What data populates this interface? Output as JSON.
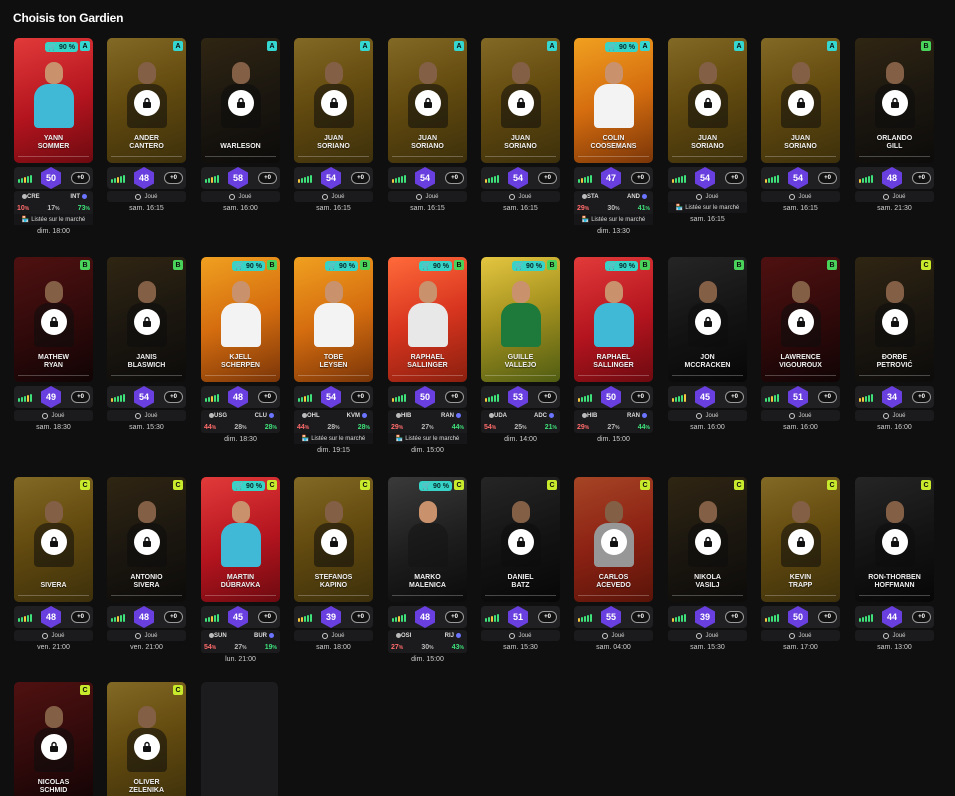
{
  "page": {
    "title": "Choisis ton Gardien"
  },
  "labels": {
    "joue": "Joué",
    "plus_zero": "+0",
    "market": "Listée sur le marché"
  },
  "colors": {
    "score": "#6a3fe0",
    "rarity_A": "#35d7d0",
    "rarity_B": "#49d35a",
    "rarity_C": "#c7ea2c",
    "bar_green": "#3ee17a",
    "bar_yellow": "#f5c842",
    "bar_red": "#ff4d4d"
  },
  "rows": [
    [
      {
        "name": "YANN\nSOMMER",
        "rarity": "A",
        "pill": "90 %",
        "skin": "red",
        "locked": false,
        "score": "50",
        "bars": [
          "g",
          "g",
          "y",
          "g",
          "g"
        ],
        "mode": "match",
        "home": "CRE",
        "away": "INT",
        "pcts": [
          "10",
          "17",
          "73"
        ],
        "market": true,
        "time": "dim. 18:00"
      },
      {
        "name": "ANDER\nCANTERO",
        "rarity": "A",
        "skin": "gold",
        "locked": true,
        "score": "48",
        "bars": [
          "g",
          "g",
          "y",
          "g",
          "g"
        ],
        "mode": "joue",
        "time": "sam. 16:15"
      },
      {
        "name": "WARLESON",
        "rarity": "A",
        "skin": "dark",
        "locked": true,
        "score": "58",
        "bars": [
          "g",
          "g",
          "y",
          "g",
          "g"
        ],
        "mode": "joue",
        "time": "sam. 16:00"
      },
      {
        "name": "JUAN\nSORIANO",
        "rarity": "A",
        "skin": "gold",
        "locked": true,
        "score": "54",
        "bars": [
          "y",
          "g",
          "g",
          "g",
          "g"
        ],
        "mode": "joue",
        "time": "sam. 16:15"
      },
      {
        "name": "JUAN\nSORIANO",
        "rarity": "A",
        "skin": "gold",
        "locked": true,
        "score": "54",
        "bars": [
          "y",
          "g",
          "g",
          "g",
          "g"
        ],
        "mode": "joue",
        "time": "sam. 16:15"
      },
      {
        "name": "JUAN\nSORIANO",
        "rarity": "A",
        "skin": "gold",
        "locked": true,
        "score": "54",
        "bars": [
          "y",
          "g",
          "g",
          "g",
          "g"
        ],
        "mode": "joue",
        "time": "sam. 16:15"
      },
      {
        "name": "COLIN\nCOOSEMANS",
        "rarity": "A",
        "pill": "90 %",
        "skin": "orange",
        "locked": false,
        "score": "47",
        "bars": [
          "g",
          "y",
          "g",
          "g",
          "g"
        ],
        "mode": "match",
        "home": "STA",
        "away": "AND",
        "pcts": [
          "29",
          "30",
          "41"
        ],
        "market": true,
        "time": "dim. 13:30"
      },
      {
        "name": "JUAN\nSORIANO",
        "rarity": "A",
        "skin": "gold",
        "locked": true,
        "score": "54",
        "bars": [
          "y",
          "g",
          "g",
          "g",
          "g"
        ],
        "mode": "joue",
        "market": true,
        "time": "sam. 16:15"
      },
      {
        "name": "JUAN\nSORIANO",
        "rarity": "A",
        "skin": "gold",
        "locked": true,
        "score": "54",
        "bars": [
          "y",
          "g",
          "g",
          "g",
          "g"
        ],
        "mode": "joue",
        "time": "sam. 16:15"
      },
      {
        "name": "ORLANDO\nGILL",
        "rarity": "B",
        "skin": "dark",
        "locked": true,
        "score": "48",
        "bars": [
          "y",
          "g",
          "g",
          "g",
          "g"
        ],
        "mode": "joue",
        "time": "sam. 21:30"
      }
    ],
    [
      {
        "name": "MATHEW\nRYAN",
        "rarity": "B",
        "skin": "darkred",
        "locked": true,
        "score": "49",
        "bars": [
          "g",
          "g",
          "g",
          "y",
          "g"
        ],
        "mode": "joue",
        "time": "sam. 18:30"
      },
      {
        "name": "JANIS\nBLASWICH",
        "rarity": "B",
        "skin": "dark",
        "locked": true,
        "score": "54",
        "bars": [
          "y",
          "g",
          "g",
          "g",
          "g"
        ],
        "mode": "joue",
        "time": "sam. 15:30"
      },
      {
        "name": "KJELL\nSCHERPEN",
        "rarity": "B",
        "pill": "90 %",
        "skin": "orange",
        "locked": false,
        "score": "48",
        "bars": [
          "g",
          "g",
          "y",
          "g",
          "g"
        ],
        "mode": "match",
        "home": "USG",
        "away": "CLU",
        "pcts": [
          "44",
          "28",
          "28"
        ],
        "time": "dim. 18:30"
      },
      {
        "name": "TOBE\nLEYSEN",
        "rarity": "B",
        "pill": "90 %",
        "skin": "orange",
        "locked": false,
        "score": "54",
        "bars": [
          "g",
          "g",
          "y",
          "g",
          "g"
        ],
        "mode": "match",
        "home": "OHL",
        "away": "KVM",
        "pcts": [
          "44",
          "28",
          "28"
        ],
        "market": true,
        "time": "dim. 19:15"
      },
      {
        "name": "Raphael\nSallinger",
        "rarity": "B",
        "pill": "90 %",
        "skin": "redorange",
        "locked": false,
        "score": "50",
        "bars": [
          "y",
          "g",
          "g",
          "g",
          "g"
        ],
        "mode": "match",
        "home": "HIB",
        "away": "RAN",
        "pcts": [
          "29",
          "27",
          "44"
        ],
        "market": true,
        "time": "dim. 15:00"
      },
      {
        "name": "GUILLE\nVALLEJO",
        "rarity": "B",
        "pill": "90 %",
        "skin": "green",
        "locked": false,
        "score": "53",
        "bars": [
          "y",
          "g",
          "g",
          "g",
          "g"
        ],
        "mode": "match",
        "home": "UDA",
        "away": "ADC",
        "pcts": [
          "54",
          "25",
          "21"
        ],
        "time": "dim. 14:00"
      },
      {
        "name": "RAPHAEL\nSALLINGER",
        "rarity": "B",
        "pill": "90 %",
        "skin": "red",
        "locked": false,
        "score": "50",
        "bars": [
          "y",
          "g",
          "g",
          "g",
          "g"
        ],
        "mode": "match",
        "home": "HIB",
        "away": "RAN",
        "pcts": [
          "29",
          "27",
          "44"
        ],
        "time": "dim. 15:00"
      },
      {
        "name": "JON\nMCCRACKEN",
        "rarity": "B",
        "skin": "black",
        "locked": true,
        "score": "45",
        "bars": [
          "y",
          "g",
          "g",
          "g",
          "y"
        ],
        "mode": "joue",
        "time": "sam. 16:00"
      },
      {
        "name": "LAWRENCE\nVIGOUROUX",
        "rarity": "B",
        "skin": "darkred",
        "locked": true,
        "score": "51",
        "bars": [
          "g",
          "g",
          "y",
          "g",
          "g"
        ],
        "mode": "joue",
        "time": "sam. 16:00"
      },
      {
        "name": "ĐORĐE\nPETROVIĆ",
        "rarity": "C",
        "skin": "dark",
        "locked": true,
        "score": "34",
        "bars": [
          "y",
          "y",
          "g",
          "g",
          "g"
        ],
        "mode": "joue",
        "time": "sam. 16:00"
      }
    ],
    [
      {
        "name": "SIVERA",
        "rarity": "C",
        "skin": "gold",
        "locked": true,
        "score": "48",
        "bars": [
          "g",
          "g",
          "y",
          "g",
          "g"
        ],
        "mode": "joue",
        "time": "ven. 21:00"
      },
      {
        "name": "ANTONIO\nSIVERA",
        "rarity": "C",
        "skin": "dark",
        "locked": true,
        "score": "48",
        "bars": [
          "g",
          "g",
          "y",
          "g",
          "g"
        ],
        "mode": "joue",
        "time": "ven. 21:00"
      },
      {
        "name": "MARTIN\nDÚBRAVKA",
        "rarity": "C",
        "pill": "90 %",
        "skin": "red",
        "locked": false,
        "score": "45",
        "bars": [
          "g",
          "g",
          "y",
          "g",
          "g"
        ],
        "mode": "match",
        "home": "SUN",
        "away": "BUR",
        "pcts": [
          "54",
          "27",
          "19"
        ],
        "time": "lun. 21:00"
      },
      {
        "name": "STEFANOS\nKAPINO",
        "rarity": "C",
        "skin": "gold",
        "locked": true,
        "score": "39",
        "bars": [
          "y",
          "y",
          "g",
          "g",
          "g"
        ],
        "mode": "joue",
        "time": "sam. 18:00"
      },
      {
        "name": "MARKO\nMALENICA",
        "rarity": "C",
        "pill": "90 %",
        "skin": "black",
        "locked": false,
        "score": "48",
        "bars": [
          "g",
          "g",
          "y",
          "g",
          "g"
        ],
        "mode": "match",
        "home": "OSI",
        "away": "RIJ",
        "pcts": [
          "27",
          "30",
          "43"
        ],
        "time": "dim. 15:00"
      },
      {
        "name": "DANIEL\nBATZ",
        "rarity": "C",
        "skin": "black",
        "locked": true,
        "score": "51",
        "bars": [
          "g",
          "g",
          "y",
          "g",
          "g"
        ],
        "mode": "joue",
        "time": "sam. 15:30"
      },
      {
        "name": "Carlos\nAcevedo",
        "rarity": "C",
        "skin": "redorange",
        "locked": true,
        "score": "55",
        "bars": [
          "y",
          "g",
          "g",
          "g",
          "g"
        ],
        "mode": "joue",
        "time": "sam. 04:00"
      },
      {
        "name": "NIKOLA\nVASILJ",
        "rarity": "C",
        "skin": "dark",
        "locked": true,
        "score": "39",
        "bars": [
          "y",
          "g",
          "g",
          "g",
          "g"
        ],
        "mode": "joue",
        "time": "sam. 15:30"
      },
      {
        "name": "KEVIN\nTRAPP",
        "rarity": "C",
        "skin": "gold",
        "locked": true,
        "score": "50",
        "bars": [
          "y",
          "g",
          "g",
          "g",
          "g"
        ],
        "mode": "joue",
        "time": "sam. 17:00"
      },
      {
        "name": "RON-THORBEN\nHOFFMANN",
        "rarity": "C",
        "skin": "black",
        "locked": true,
        "score": "44",
        "bars": [
          "g",
          "g",
          "g",
          "g",
          "g"
        ],
        "mode": "joue",
        "time": "sam. 13:00"
      }
    ],
    [
      {
        "name": "NICOLAS\nSCHMID",
        "rarity": "C",
        "skin": "darkred",
        "locked": true
      },
      {
        "name": "OLIVER\nZELENIKA",
        "rarity": "C",
        "skin": "gold",
        "locked": true
      },
      {
        "empty": true
      }
    ]
  ]
}
